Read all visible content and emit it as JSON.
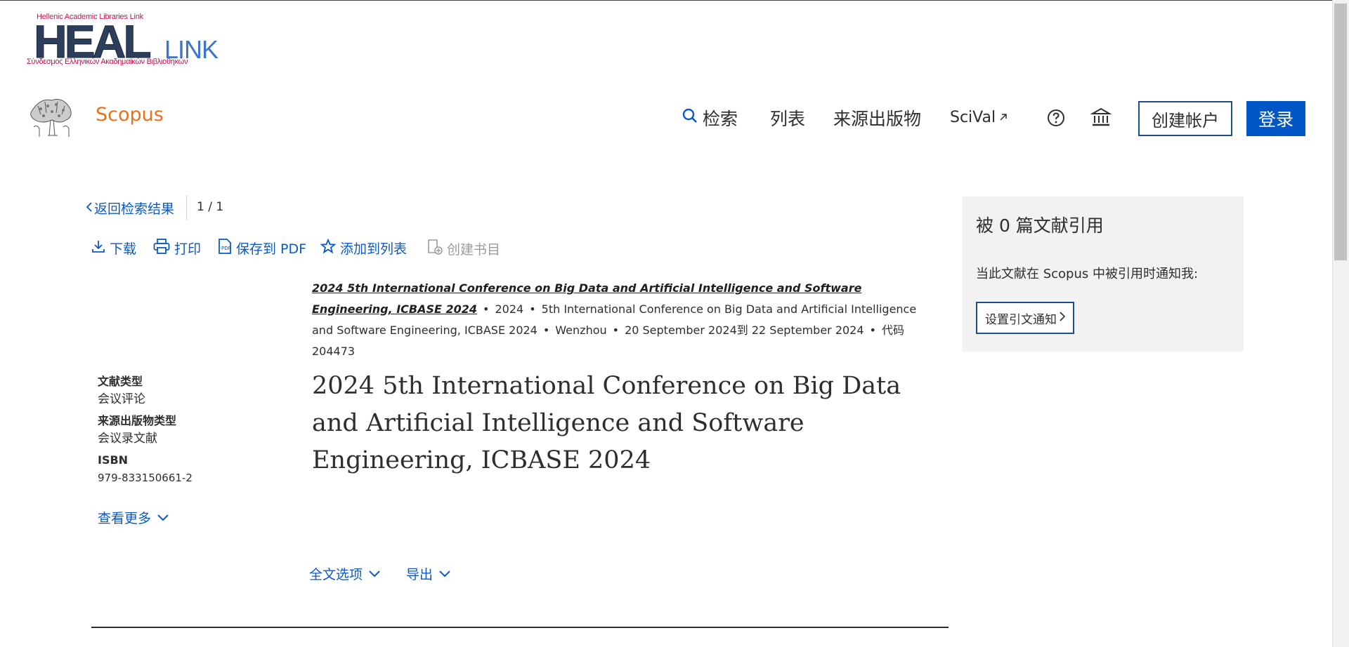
{
  "branding": {
    "heal_small": "Hellenic Academic Libraries Link",
    "heal_big": "HEAL",
    "heal_link": "LINK",
    "heal_sub": "Σύνδεσμος Ελληνικών Ακαδημαϊκών Βιβλιοθηκών",
    "scopus": "Scopus"
  },
  "nav": {
    "search": "检索",
    "lists": "列表",
    "sources": "来源出版物",
    "scival": "SciVal",
    "create_account": "创建帐户",
    "login": "登录"
  },
  "breadcrumb": {
    "back": "返回检索结果",
    "pager": "1 / 1"
  },
  "toolbar": {
    "download": "下载",
    "print": "打印",
    "save_pdf": "保存到 PDF",
    "add_to_list": "添加到列表",
    "create_bib": "创建书目"
  },
  "source": {
    "link": "2024 5th International Conference on Big Data and Artificial Intelligence and Software Engineering, ICBASE 2024",
    "year": "2024",
    "conf_name": "5th International Conference on Big Data and Artificial Intelligence and Software Engineering, ICBASE 2024",
    "location": "Wenzhou",
    "dates": "20 September 2024到 22 September 2024",
    "code": "代码 204473"
  },
  "meta": {
    "doc_type_label": "文献类型",
    "doc_type_value": "会议评论",
    "source_type_label": "来源出版物类型",
    "source_type_value": "会议录文献",
    "isbn_label": "ISBN",
    "isbn_value": "979-833150661-2",
    "see_more": "查看更多"
  },
  "document": {
    "title": "2024 5th International Conference on Big Data and Artificial Intelligence and Software Engineering, ICBASE 2024"
  },
  "actions": {
    "full_text_options": "全文选项",
    "export": "导出"
  },
  "cited": {
    "title": "被 0 篇文献引用",
    "desc": "当此文献在 Scopus 中被引用时通知我:",
    "button": "设置引文通知"
  },
  "colors": {
    "link_blue": "#0b59c8",
    "scopus_orange": "#e9711c",
    "login_blue": "#0056c7",
    "panel_gray": "#f2f2f2"
  }
}
